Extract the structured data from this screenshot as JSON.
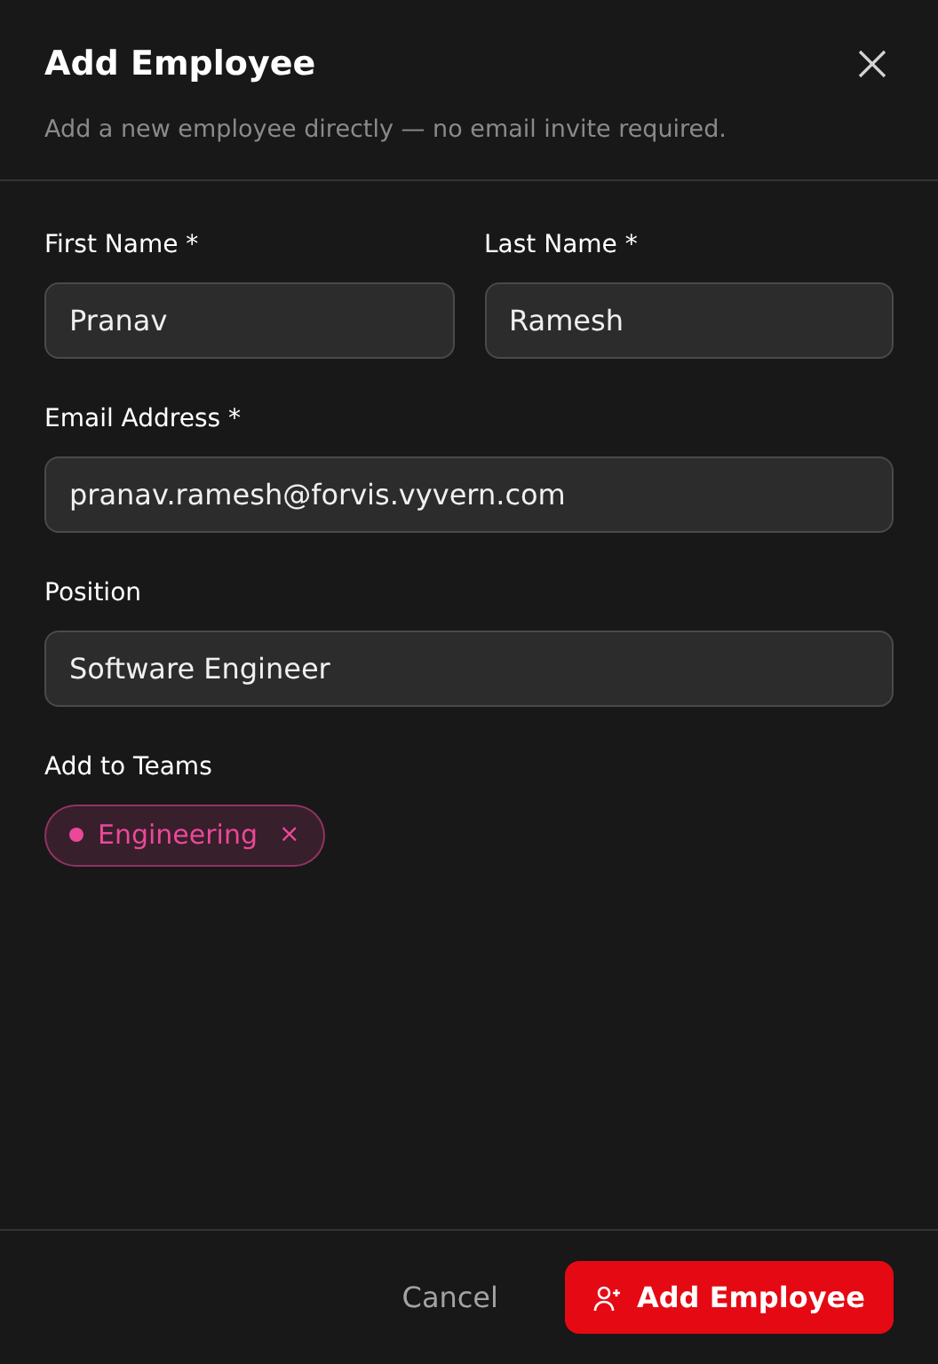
{
  "dialog": {
    "title": "Add Employee",
    "subtitle": "Add a new employee directly — no email invite required."
  },
  "fields": [
    {
      "label": "First Name *",
      "value": "Pranav"
    },
    {
      "label": "Last Name *",
      "value": "Ramesh"
    },
    {
      "label": "Email Address *",
      "value": "pranav.ramesh@forvis.vyvern.com"
    },
    {
      "label": "Position",
      "value": "Software Engineer"
    }
  ],
  "teams": {
    "label": "Add to Teams",
    "tags": [
      {
        "name": "Engineering",
        "color": "#ec4899",
        "remove": "×"
      }
    ]
  },
  "buttons": {
    "cancel": "Cancel",
    "submit": "Add Employee"
  }
}
